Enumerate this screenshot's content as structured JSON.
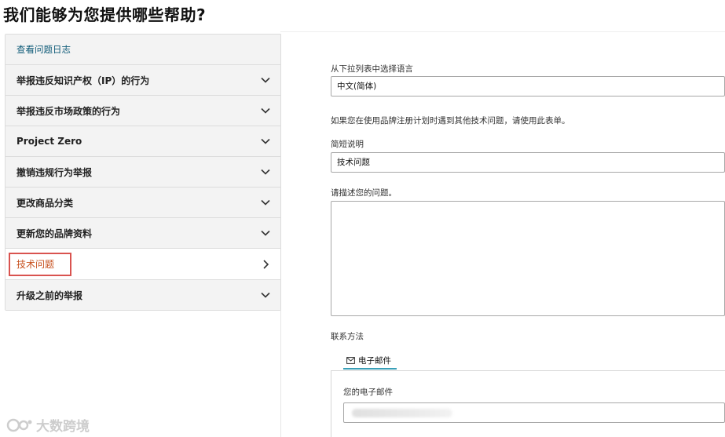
{
  "page": {
    "title": "我们能够为您提供哪些帮助?"
  },
  "sidebar": {
    "items": [
      {
        "label": "查看问题日志",
        "type": "link"
      },
      {
        "label": "举报违反知识产权（IP）的行为",
        "type": "expand"
      },
      {
        "label": "举报违反市场政策的行为",
        "type": "expand"
      },
      {
        "label": "Project Zero",
        "type": "expand"
      },
      {
        "label": "撤销违规行为举报",
        "type": "expand"
      },
      {
        "label": "更改商品分类",
        "type": "expand"
      },
      {
        "label": "更新您的品牌资料",
        "type": "expand"
      },
      {
        "label": "技术问题",
        "type": "active"
      },
      {
        "label": "升级之前的举报",
        "type": "expand"
      }
    ]
  },
  "form": {
    "language_label": "从下拉列表中选择语言",
    "language_value": "中文(简体)",
    "info_text": "如果您在使用品牌注册计划时遇到其他技术问题，请使用此表单。",
    "summary_label": "简短说明",
    "summary_value": "技术问题",
    "description_label": "请描述您的问题。",
    "contact_label": "联系方法",
    "email_tab_label": "电子邮件",
    "email_field_label": "您的电子邮件"
  },
  "watermark": {
    "text": "大数跨境"
  },
  "colors": {
    "active_text": "#c7511f",
    "link_text": "#0f5b78",
    "highlight_border": "#d9534f",
    "tab_accent": "#3aa0b8"
  }
}
